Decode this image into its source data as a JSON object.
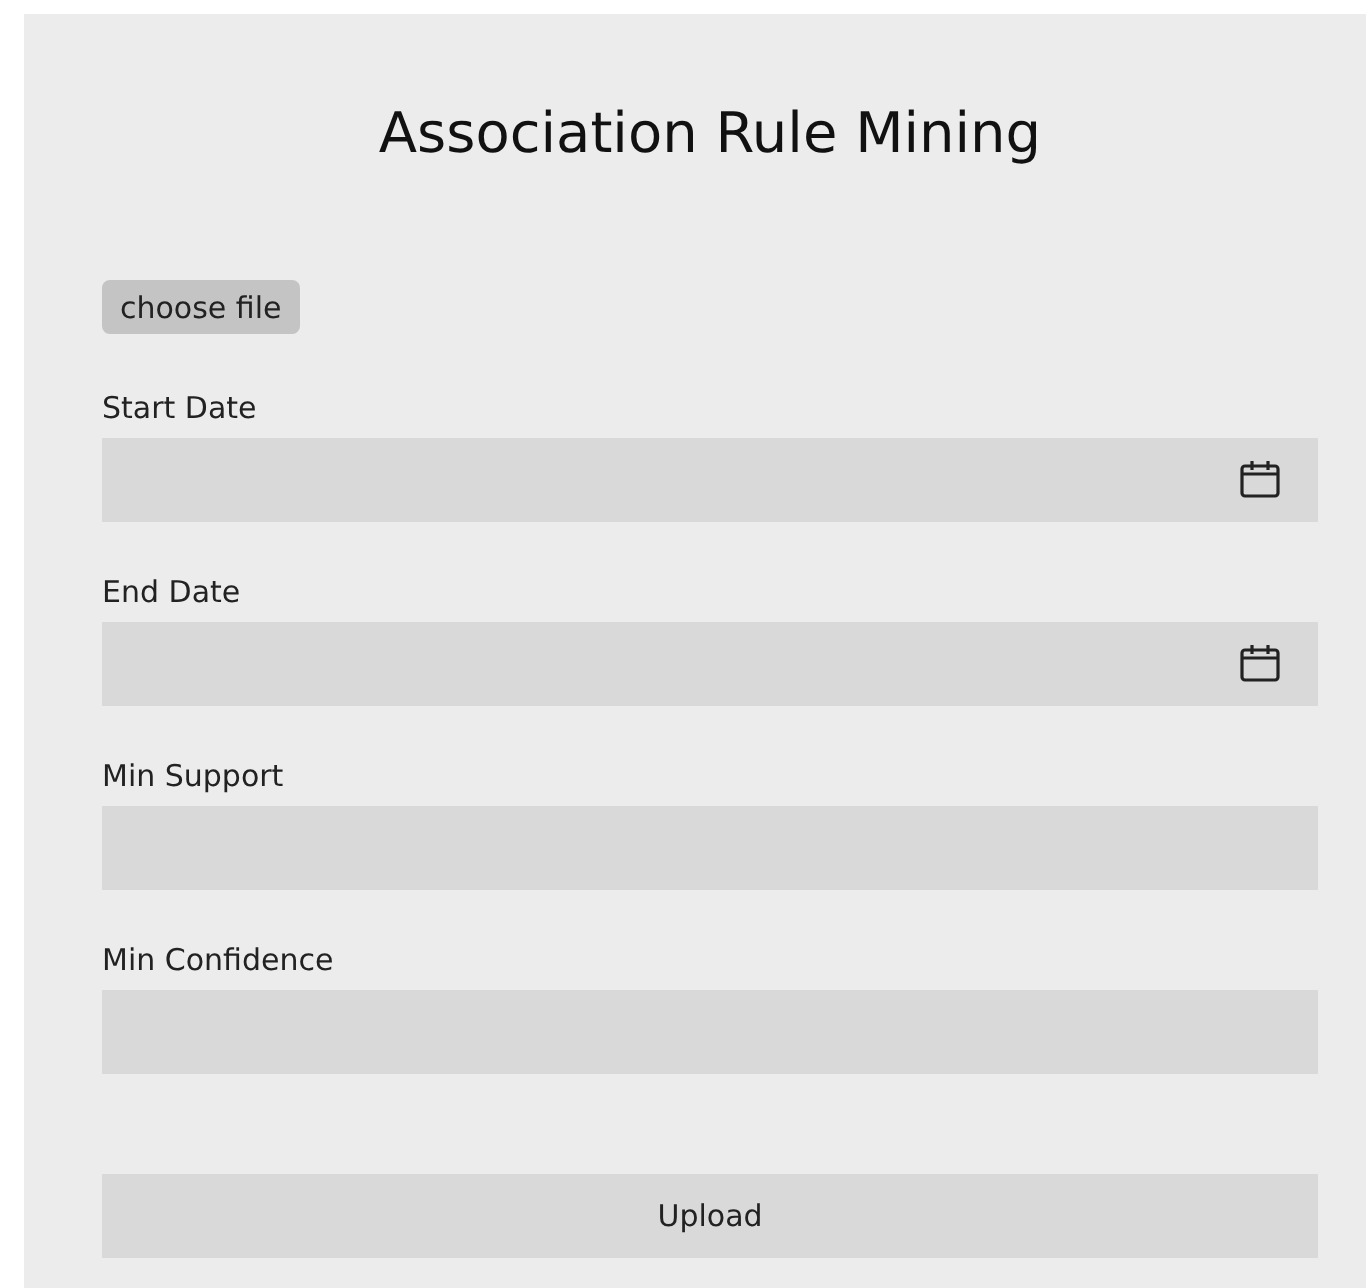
{
  "title": "Association Rule Mining",
  "file_button": "choose file",
  "fields": [
    {
      "label": "Start Date",
      "kind": "date"
    },
    {
      "label": "End Date",
      "kind": "date"
    },
    {
      "label": "Min Support",
      "kind": "text"
    },
    {
      "label": "Min Confidence",
      "kind": "text"
    }
  ],
  "submit_button": "Upload"
}
